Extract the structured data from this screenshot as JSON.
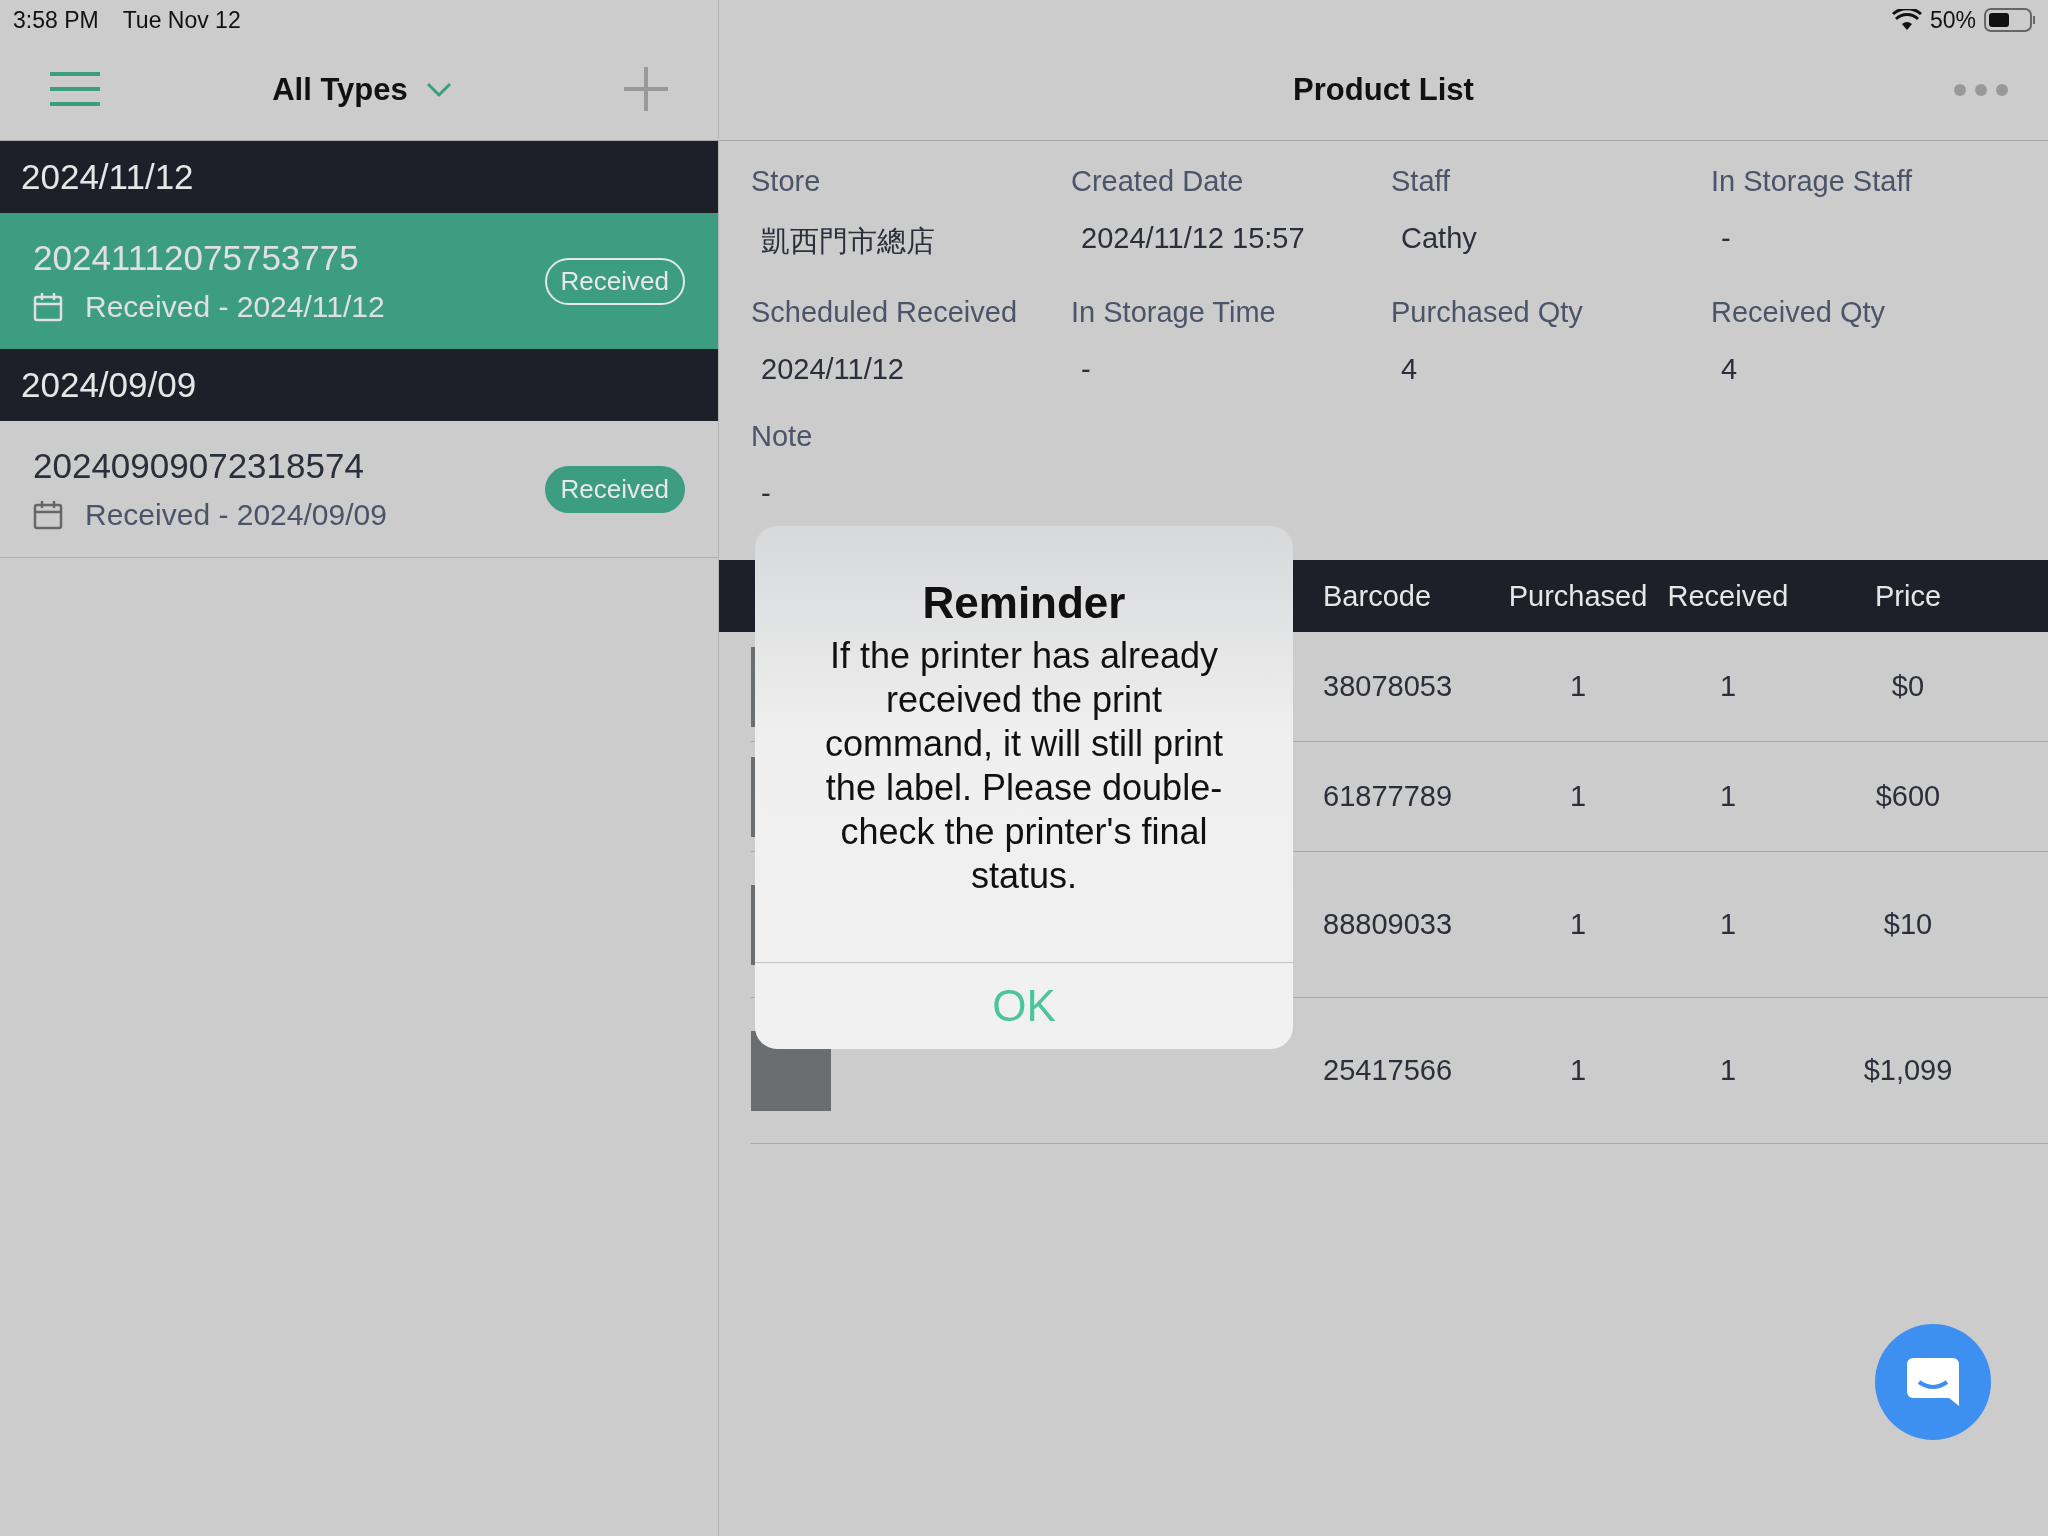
{
  "status_bar": {
    "time": "3:58 PM",
    "date": "Tue Nov 12",
    "battery": "50%"
  },
  "sidebar": {
    "filter": "All Types",
    "groups": [
      {
        "date": "2024/11/12",
        "orders": [
          {
            "number": "20241112075753775",
            "subtitle": "Received - 2024/11/12",
            "status": "Received",
            "selected": true
          }
        ]
      },
      {
        "date": "2024/09/09",
        "orders": [
          {
            "number": "20240909072318574",
            "subtitle": "Received - 2024/09/09",
            "status": "Received",
            "selected": false
          }
        ]
      }
    ]
  },
  "detail": {
    "title": "Product List",
    "fields": [
      {
        "label": "Store",
        "value": "凱西門市總店"
      },
      {
        "label": "Created Date",
        "value": "2024/11/12 15:57"
      },
      {
        "label": "Staff",
        "value": "Cathy"
      },
      {
        "label": "In Storage Staff",
        "value": "-"
      },
      {
        "label": "Scheduled Received",
        "value": "2024/11/12"
      },
      {
        "label": "In Storage Time",
        "value": "-"
      },
      {
        "label": "Purchased Qty",
        "value": "4"
      },
      {
        "label": "Received Qty",
        "value": "4"
      },
      {
        "label": "Note",
        "value": "-"
      }
    ],
    "table": {
      "columns": [
        "Barcode",
        "Purchased",
        "Received",
        "Price"
      ],
      "rows": [
        {
          "barcode": "38078053",
          "purchased": "1",
          "received": "1",
          "price": "$0",
          "tall": false
        },
        {
          "barcode": "61877789",
          "purchased": "1",
          "received": "1",
          "price": "$600",
          "tall": false
        },
        {
          "barcode": "88809033",
          "purchased": "1",
          "received": "1",
          "price": "$10",
          "tall": true
        },
        {
          "barcode": "25417566",
          "purchased": "1",
          "received": "1",
          "price": "$1,099",
          "tall": true
        }
      ]
    }
  },
  "dialog": {
    "title": "Reminder",
    "message": "If the printer has already received the print command, it will still print the label. Please double-check the printer's final status.",
    "button": "OK"
  }
}
